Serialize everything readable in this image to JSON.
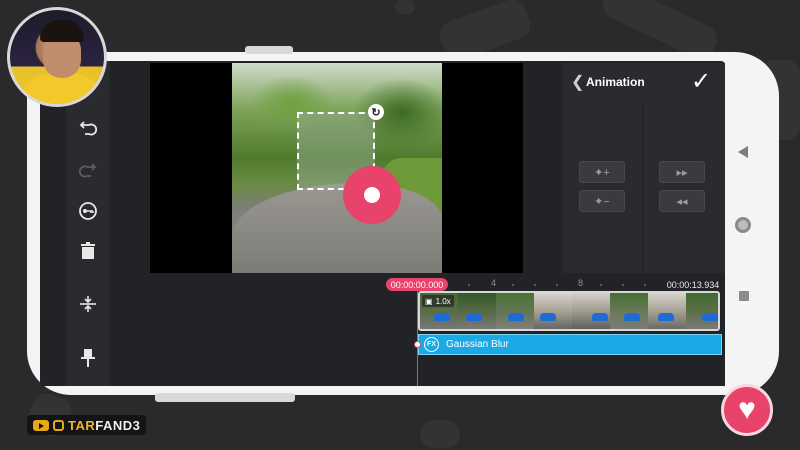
{
  "icons": {
    "undo": "undo-icon",
    "redo": "redo-icon",
    "keyframe": "key-icon",
    "delete": "trash-icon",
    "split": "split-icon",
    "pin": "pin-icon"
  },
  "animation_panel": {
    "title": "Animation",
    "add_keyframe": "✦+",
    "remove_keyframe": "✦−",
    "next_keyframe": "▸▸",
    "prev_keyframe": "◂◂"
  },
  "timeline": {
    "time_start": "00:00:00.000",
    "time_end": "00:00:13.934",
    "ruler": [
      "4",
      "8"
    ],
    "speed_badge": "1.0x",
    "effect_label": "Gaussian Blur",
    "fx_badge": "FX"
  },
  "brand": {
    "text_accent": "TAR",
    "text_rest": "FAND3"
  },
  "colors": {
    "accent": "#e8436a",
    "effect_track": "#1aa8e6",
    "panel": "#2a2b2f",
    "background": "#2a2a2c"
  }
}
